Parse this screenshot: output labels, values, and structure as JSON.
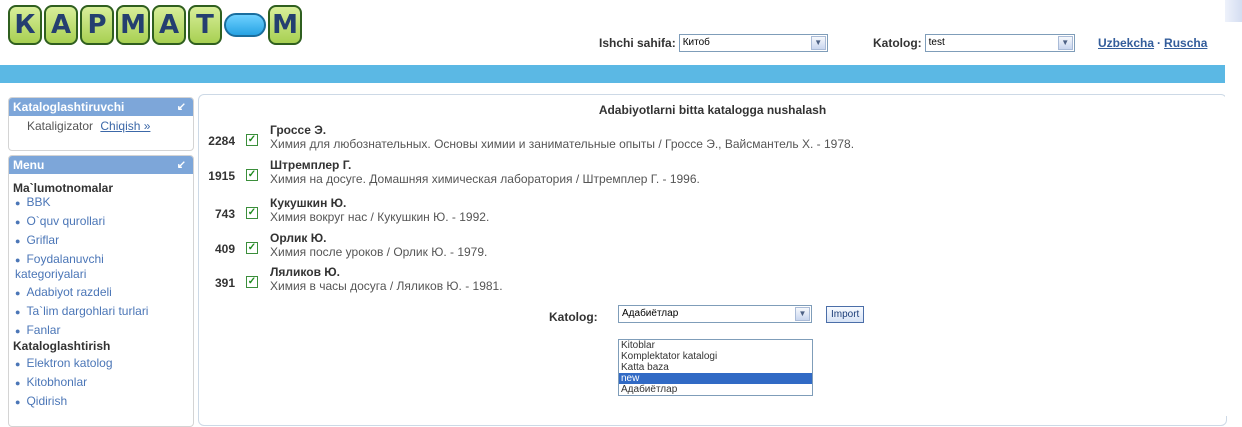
{
  "logo": {
    "letters": [
      "К",
      "А",
      "Р",
      "М",
      "А",
      "Т",
      "",
      "М"
    ]
  },
  "header": {
    "workpage_label": "Ishchi sahifa:",
    "workpage_value": "Китоб",
    "catalog_label": "Katolog:",
    "catalog_value": "test",
    "lang_uz": "Uzbekcha",
    "lang_sep": "·",
    "lang_ru": "Ruscha"
  },
  "sidebar": {
    "cataloger_title": "Kataloglashtiruvchi",
    "cataloger_user": "Kataligizator",
    "logout": "Chiqish »",
    "menu_title": "Menu",
    "sections": [
      {
        "title": "Ma`lumotnomalar",
        "items": [
          "BBK",
          "O`quv qurollari",
          "Griflar",
          "Foydalanuvchi kategoriyalari",
          "Adabiyot razdeli",
          "Ta`lim dargohlari turlari",
          "Fanlar"
        ]
      },
      {
        "title": "Kataloglashtirish",
        "items": [
          "Elektron katolog",
          "Kitobhonlar",
          "Qidirish"
        ]
      }
    ]
  },
  "main": {
    "title": "Adabiyotlarni bitta katalogga nushalash",
    "rows": [
      {
        "count": "2284",
        "author": "Гроссе Э.",
        "desc": "Химия для любознательных. Основы химии и занимательные опыты / Гроссе Э., Вайсмантель Х. - 1978."
      },
      {
        "count": "1915",
        "author": "Штремплер Г.",
        "desc": "Химия на досуге. Домашняя химическая лаборатория / Штремплер Г. - 1996."
      },
      {
        "count": "743",
        "author": "Кукушкин Ю.",
        "desc": "Химия вокруг нас / Кукушкин Ю. - 1992."
      },
      {
        "count": "409",
        "author": "Орлик Ю.",
        "desc": "Химия после уроков / Орлик Ю. - 1979."
      },
      {
        "count": "391",
        "author": "Ляликов Ю.",
        "desc": "Химия в часы досуга / Ляликов Ю. - 1981."
      }
    ],
    "katalog_label": "Katolog:",
    "katalog_value": "Адабиётлар",
    "import_label": "Import",
    "dropdown_options": [
      "Kitoblar",
      "Komplektator katalogi",
      "Katta baza",
      "new",
      "Адабиётлар"
    ],
    "dropdown_selected": "new"
  }
}
